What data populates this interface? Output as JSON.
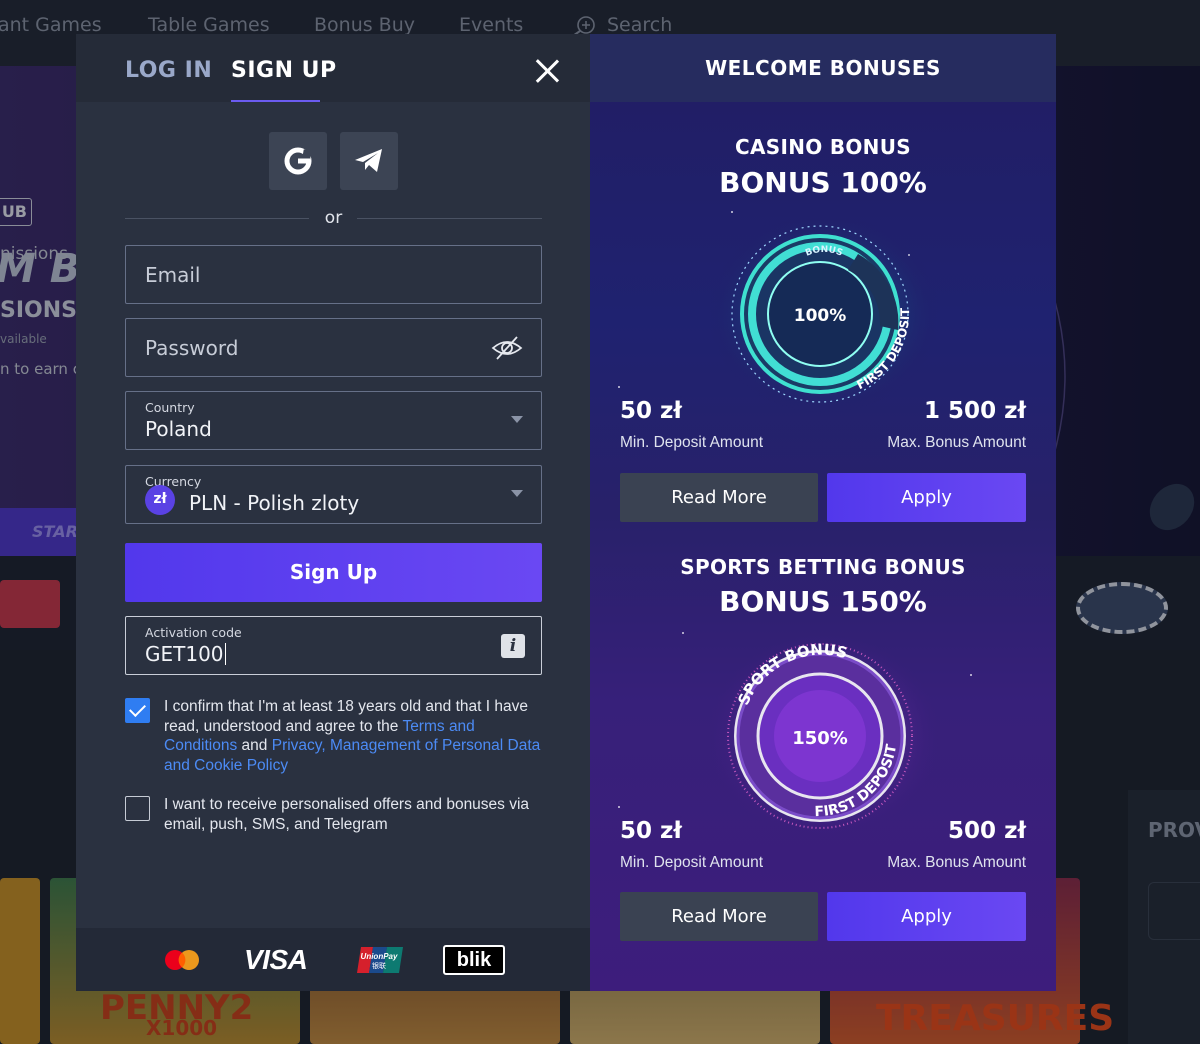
{
  "background": {
    "nav": [
      "ant Games",
      "Table Games",
      "Bonus Buy",
      "Events",
      "Search"
    ],
    "club_badge": "UB",
    "hero_title": "M BO",
    "lines": [
      "nissions",
      "SIONS",
      "vailable",
      "n to earn co"
    ],
    "start_button": "START",
    "side_card_label": "PROV",
    "tiles": [
      "PENNY2",
      "X1000",
      "TREASURES"
    ]
  },
  "modal": {
    "tabs": {
      "login": "LOG IN",
      "signup": "SIGN UP"
    },
    "or_label": "or",
    "email": {
      "placeholder": "Email"
    },
    "password": {
      "placeholder": "Password"
    },
    "country": {
      "label": "Country",
      "value": "Poland"
    },
    "currency": {
      "label": "Currency",
      "symbol": "zł",
      "value": "PLN - Polish zloty"
    },
    "signup_button": "Sign Up",
    "activation": {
      "label": "Activation code",
      "value": "GET100"
    },
    "consent_age": {
      "text_before": "I confirm that I'm at least 18 years old and that I have read, understood and agree to the ",
      "terms_link": "Terms and Conditions",
      "and": " and ",
      "privacy_link": "Privacy, Management of Personal Data and Cookie Policy",
      "checked": true
    },
    "consent_offers": {
      "text": "I want to receive personalised offers and bonuses via email, push, SMS, and Telegram",
      "checked": false
    },
    "payments": [
      "mastercard",
      "VISA",
      "UnionPay",
      "blik"
    ],
    "unionpay_text": "UnionPay",
    "unionpay_cn": "银联",
    "blik_text": "blik"
  },
  "bonuses": {
    "header": "WELCOME BONUSES",
    "items": [
      {
        "title": "CASINO BONUS",
        "headline": "BONUS 100%",
        "emblem_top": "BONUS",
        "emblem_center": "100%",
        "emblem_ring": "FIRST DEPOSIT",
        "min_deposit": "50 zł",
        "min_caption": "Min. Deposit Amount",
        "max_bonus": "1 500 zł",
        "max_caption": "Max. Bonus Amount",
        "read_more": "Read More",
        "apply": "Apply"
      },
      {
        "title": "SPORTS BETTING BONUS",
        "headline": "BONUS 150%",
        "emblem_top": "SPORT BONUS",
        "emblem_center": "150%",
        "emblem_ring": "FIRST DEPOSIT",
        "min_deposit": "50 zł",
        "min_caption": "Min. Deposit Amount",
        "max_bonus": "500 zł",
        "max_caption": "Max. Bonus Amount",
        "read_more": "Read More",
        "apply": "Apply"
      }
    ]
  },
  "colors": {
    "accent": "#5a42e4",
    "checkbox": "#2f7df2",
    "link": "#4c8bf5",
    "panel": "#2a3140"
  }
}
